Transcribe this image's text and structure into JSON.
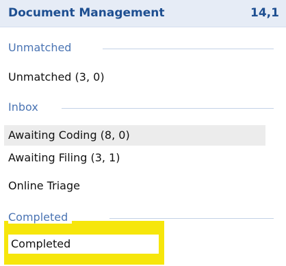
{
  "header": {
    "title": "Document Management",
    "count": "14,1"
  },
  "groups": {
    "unmatched": {
      "label": "Unmatched",
      "items": [
        "Unmatched (3, 0)"
      ]
    },
    "inbox": {
      "label": "Inbox",
      "items": [
        "Awaiting Coding (8, 0)",
        "Awaiting Filing (3, 1)",
        "Online Triage"
      ]
    },
    "completed": {
      "label": "Completed",
      "items": [
        "Completed"
      ]
    }
  },
  "colors": {
    "heading_text": "#1e4f91",
    "group_label": "#4a74b3",
    "highlight": "#f6e60c",
    "selected_row": "#ececec"
  }
}
